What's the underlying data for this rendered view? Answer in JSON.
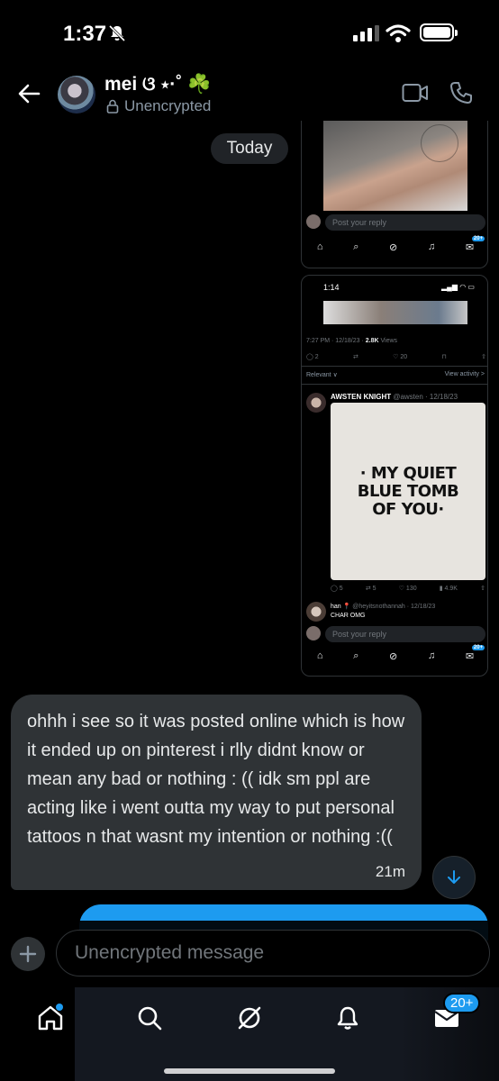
{
  "status_bar": {
    "time": "1:37"
  },
  "header": {
    "contact_name": "mei ଓ ⋆·˚ ☘️",
    "encryption_label": "Unencrypted"
  },
  "date_divider": "Today",
  "screenshot1": {
    "reply_placeholder": "Post your reply",
    "badge": "20+"
  },
  "screenshot2": {
    "status_time": "1:14",
    "meta_prefix": "7:27 PM · 12/18/23 · ",
    "views_count": "2.8K",
    "views_label": " Views",
    "action_counts": {
      "replies": "2",
      "likes": "20"
    },
    "relevant_label": "Relevant ∨",
    "view_activity_label": "View activity >",
    "tweet_author": "AWSTEN KNIGHT",
    "tweet_handle": " @awsten · 12/18/23",
    "tattoo_lines": [
      "· MY QUIET",
      "BLUE TOMB",
      "OF YOU·"
    ],
    "tweet_counts": {
      "replies": "5",
      "retweets": "5",
      "likes": "130",
      "views": "4.9K"
    },
    "reply_author": "han 📍",
    "reply_handle": " @heyitsnothannah · 12/18/23",
    "reply_text": "CHAR OMG",
    "reply_placeholder": "Post your reply",
    "badge": "20+"
  },
  "message": {
    "text": "ohhh i see so it was posted online which is how it ended up on pinterest i rlly didnt know or mean any bad or nothing : (( idk sm ppl are acting like i went outta my way to put personal tattoos n that wasnt my intention or nothing :((",
    "time": "21m"
  },
  "compose": {
    "placeholder": "Unencrypted message"
  },
  "bottom_nav": {
    "messages_badge": "20+"
  },
  "colors": {
    "accent": "#1d9bf0",
    "bubble": "#2f3336",
    "muted": "#71767b"
  }
}
